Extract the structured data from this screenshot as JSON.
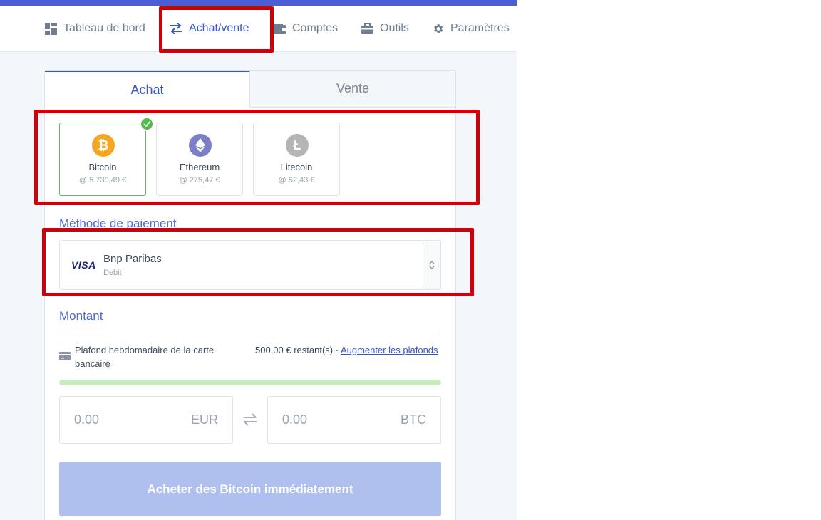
{
  "nav": {
    "items": [
      {
        "label": "Tableau de bord",
        "icon": "dashboard-icon",
        "active": false
      },
      {
        "label": "Achat/vente",
        "icon": "swap-arrows-icon",
        "active": true
      },
      {
        "label": "Comptes",
        "icon": "wallet-icon",
        "active": false
      },
      {
        "label": "Outils",
        "icon": "toolbox-icon",
        "active": false
      },
      {
        "label": "Paramètres",
        "icon": "gear-icon",
        "active": false
      }
    ]
  },
  "tabs": {
    "buy": "Achat",
    "sell": "Vente"
  },
  "coins": [
    {
      "name": "Bitcoin",
      "price": "@ 5 730,49 €",
      "icon": "bitcoin-icon",
      "color": "#f5a623",
      "selected": true
    },
    {
      "name": "Ethereum",
      "price": "@ 275,47 €",
      "icon": "ethereum-icon",
      "color": "#7b7fc6",
      "selected": false
    },
    {
      "name": "Litecoin",
      "price": "@ 52,43 €",
      "icon": "litecoin-icon",
      "color": "#b5b5b5",
      "selected": false
    }
  ],
  "payment": {
    "title": "Méthode de paiement",
    "logo": "VISA",
    "name": "Bnp Paribas",
    "type": "Debit ·"
  },
  "amount": {
    "title": "Montant",
    "limit_label": "Plafond hebdomadaire de la carte bancaire",
    "limit_value": "500,00 € restant(s) · ",
    "limit_link": "Augmenter les plafonds",
    "limit_remaining_fraction": 1.0,
    "eur_value": "0.00",
    "eur_currency": "EUR",
    "btc_value": "0.00",
    "btc_currency": "BTC"
  },
  "buy_button": "Acheter des Bitcoin immédiatement",
  "colors": {
    "accent": "#3a55c6",
    "highlight": "#d0000a",
    "success": "#55b94b"
  }
}
